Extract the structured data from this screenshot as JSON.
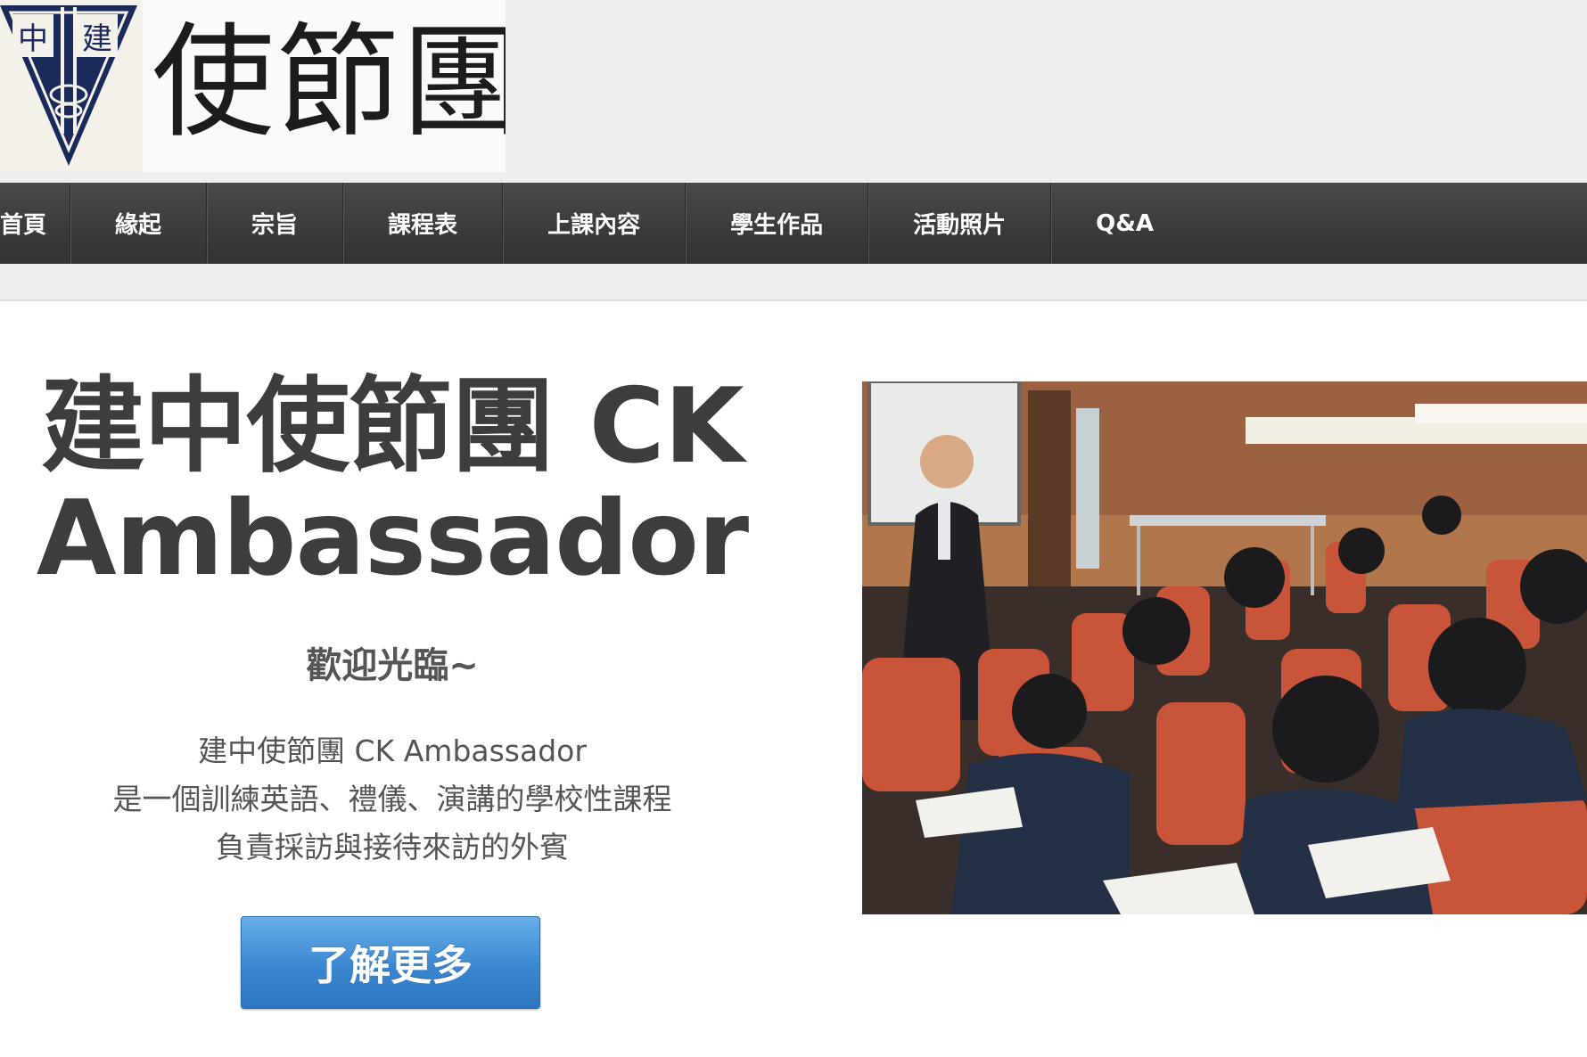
{
  "logo": {
    "emblem_chars": [
      "中",
      "建"
    ],
    "title": "使節團"
  },
  "nav": {
    "items": [
      "首頁",
      "緣起",
      "宗旨",
      "課程表",
      "上課內容",
      "學生作品",
      "活動照片",
      "Q&A"
    ]
  },
  "hero": {
    "title_line1": "建中使節團 CK",
    "title_line2": "Ambassador",
    "subtitle": "歡迎光臨~",
    "desc": [
      "建中使節團 CK Ambassador",
      "是一個訓練英語、禮儀、演講的學校性課程",
      "負責採訪與接待來訪的外賓"
    ],
    "cta_label": "了解更多"
  },
  "colors": {
    "nav_bg": "#3b3b3b",
    "button_blue": "#3b86d0",
    "page_bg": "#efefef"
  }
}
